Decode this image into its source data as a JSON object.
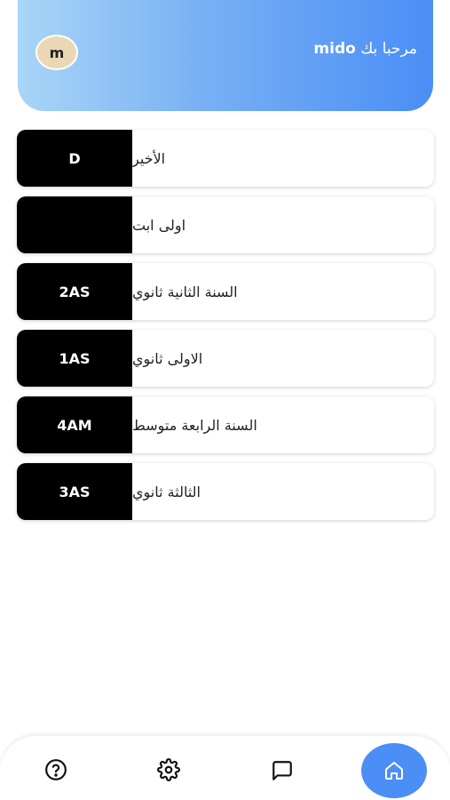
{
  "header": {
    "avatar_letter": "m",
    "greeting_prefix": "مرحبا بك",
    "username": "mido"
  },
  "levels": [
    {
      "label": "الأخير",
      "code": "D"
    },
    {
      "label": "اولى ابت",
      "code": ""
    },
    {
      "label": "السنة الثانية ثانوي",
      "code": "2AS"
    },
    {
      "label": "الاولى ثانوي",
      "code": "1AS"
    },
    {
      "label": "السنة الرابعة متوسط",
      "code": "4AM"
    },
    {
      "label": "الثالثة ثانوي",
      "code": "3AS"
    }
  ],
  "nav": {
    "items": [
      "help-icon",
      "settings-icon",
      "chat-icon",
      "home-icon"
    ],
    "active": "home-icon",
    "accent_color": "#4a8ef6"
  }
}
